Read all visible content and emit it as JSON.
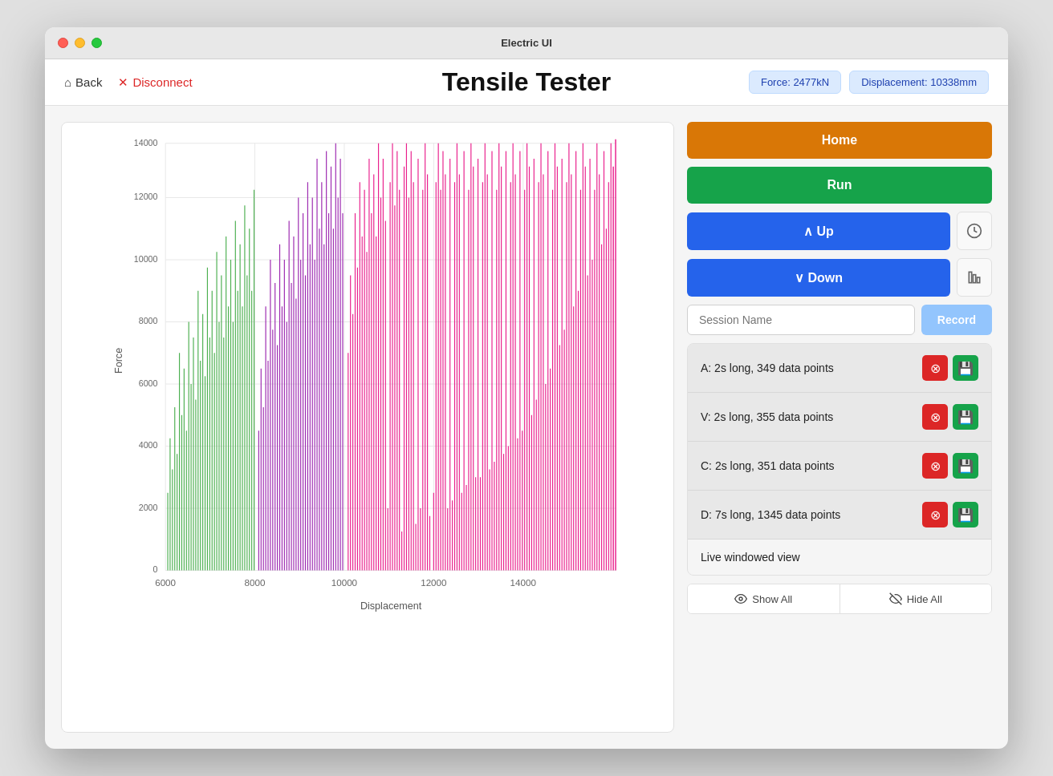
{
  "window": {
    "title": "Electric UI"
  },
  "header": {
    "back_label": "Back",
    "disconnect_label": "Disconnect",
    "app_title": "Tensile Tester",
    "force_badge": "Force: 2477kN",
    "displacement_badge": "Displacement: 10338mm"
  },
  "buttons": {
    "home": "Home",
    "run": "Run",
    "up": "↑  Up",
    "down": "↓  Down",
    "record": "Record",
    "show_all": "Show All",
    "hide_all": "Hide All"
  },
  "session_input": {
    "placeholder": "Session Name"
  },
  "sessions": [
    {
      "id": "A",
      "label": "A: 2s long, 349 data points"
    },
    {
      "id": "B",
      "label": "V: 2s long, 355 data points"
    },
    {
      "id": "C",
      "label": "C: 2s long, 351 data points"
    },
    {
      "id": "D",
      "label": "D: 7s long, 1345 data points"
    },
    {
      "id": "live",
      "label": "Live windowed view",
      "live": true
    }
  ],
  "chart": {
    "x_axis_title": "Displacement",
    "y_axis_title": "Force",
    "x_ticks": [
      "6000",
      "8000",
      "10000",
      "12000",
      "14000"
    ],
    "y_ticks": [
      "2000",
      "4000",
      "6000",
      "8000",
      "10000",
      "12000",
      "14000"
    ],
    "colors": {
      "green": "#4caf50",
      "purple": "#9c27b0",
      "pink": "#e91e8c"
    }
  }
}
